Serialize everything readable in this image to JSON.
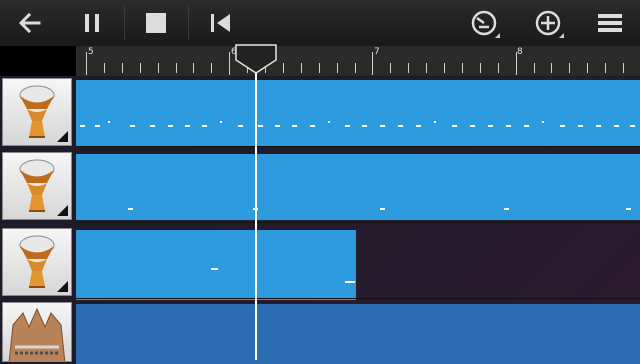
{
  "toolbar": {
    "buttons": [
      {
        "id": "back",
        "icon": "back-arrow-icon"
      },
      {
        "id": "pause",
        "icon": "pause-icon"
      },
      {
        "id": "stop",
        "icon": "stop-icon"
      },
      {
        "id": "rewind",
        "icon": "skip-to-start-icon"
      },
      {
        "id": "metronome",
        "icon": "metronome-dial-icon"
      },
      {
        "id": "add",
        "icon": "add-circle-icon"
      },
      {
        "id": "menu",
        "icon": "menu-icon"
      }
    ]
  },
  "ruler": {
    "bar_labels": [
      "5",
      "6",
      "7",
      "8"
    ]
  },
  "tracks": [
    {
      "instrument": "djembe",
      "icon": "djembe-drum-icon"
    },
    {
      "instrument": "djembe",
      "icon": "djembe-drum-icon"
    },
    {
      "instrument": "djembe",
      "icon": "djembe-drum-icon"
    },
    {
      "instrument": "kalimba",
      "icon": "kalimba-icon"
    }
  ],
  "colors": {
    "region": "#2f9bdf",
    "region_dark": "#2b6db0",
    "toolbar": "#1f1f1f",
    "note": "#ffffff"
  }
}
